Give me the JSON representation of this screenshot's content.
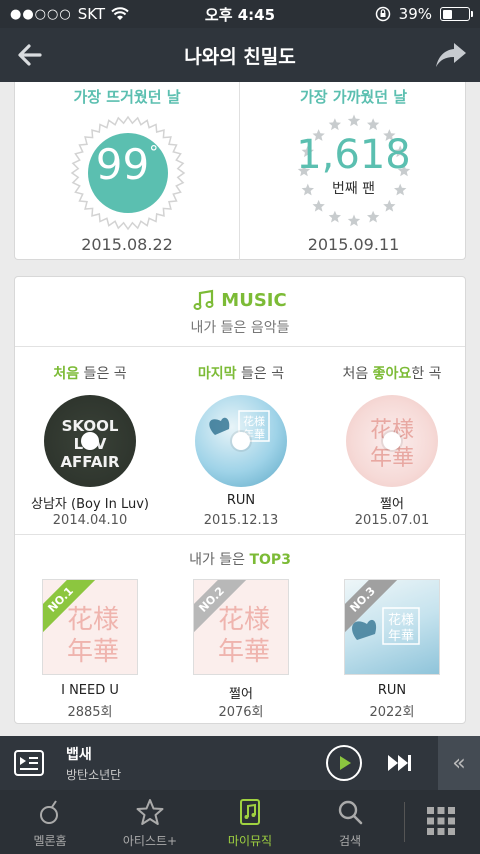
{
  "status": {
    "carrier": "SKT",
    "time": "오후 4:45",
    "battery": "39%",
    "battery_level": 0.39
  },
  "nav": {
    "title": "나와의 친밀도"
  },
  "intimacy": {
    "hottest": {
      "label": "가장 뜨거웠던 날",
      "value": "99",
      "unit": "°",
      "date": "2015.08.22"
    },
    "closest": {
      "label": "가장 가까웠던 날",
      "value": "1,618",
      "rank_label": "번째 팬",
      "date": "2015.09.11"
    }
  },
  "music": {
    "title": "MUSIC",
    "subtitle": "내가 들은 음악들",
    "columns": [
      {
        "head_hl": "처음",
        "head_rest": " 들은 곡",
        "title": "상남자 (Boy In Luv)",
        "date": "2014.04.10",
        "cover_text": "SKOOL LUV AFFAIR"
      },
      {
        "head_hl": "마지막",
        "head_rest": " 들은 곡",
        "title": "RUN",
        "date": "2015.12.13",
        "cover_text": "花様年華"
      },
      {
        "head_pre": "처음 ",
        "head_hl": "좋아요",
        "head_rest": "한 곡",
        "title": "쩔어",
        "date": "2015.07.01",
        "cover_text": "花様年華"
      }
    ],
    "top3_pre": "내가 들은 ",
    "top3_hl": "TOP3",
    "top3": [
      {
        "rank": "NO.1",
        "title": "I NEED U",
        "count": "2885회"
      },
      {
        "rank": "NO.2",
        "title": "쩔어",
        "count": "2076회"
      },
      {
        "rank": "NO.3",
        "title": "RUN",
        "count": "2022회"
      }
    ]
  },
  "player": {
    "song": "뱁새",
    "artist": "방탄소년단",
    "collapse_glyph": "«"
  },
  "tabs": [
    {
      "label": "멜론홈",
      "icon": "melon-icon"
    },
    {
      "label": "아티스트+",
      "icon": "star-icon"
    },
    {
      "label": "마이뮤직",
      "icon": "music-note-icon",
      "active": true
    },
    {
      "label": "검색",
      "icon": "search-icon"
    }
  ],
  "colors": {
    "accent_teal": "#5bbfb0",
    "accent_green": "#7cbb36",
    "tab_active": "#9fd140"
  }
}
